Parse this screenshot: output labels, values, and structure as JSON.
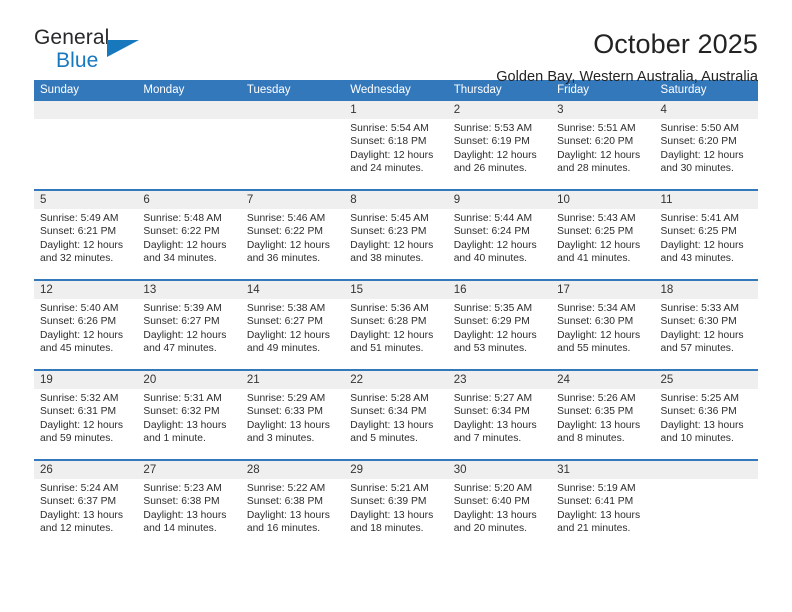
{
  "brand": {
    "name_top": "General",
    "name_bottom": "Blue",
    "triangle_color": "#1878be"
  },
  "header": {
    "month_title": "October 2025",
    "location": "Golden Bay, Western Australia, Australia",
    "accent_color": "#3478bc"
  },
  "weekdays": [
    "Sunday",
    "Monday",
    "Tuesday",
    "Wednesday",
    "Thursday",
    "Friday",
    "Saturday"
  ],
  "weeks": [
    [
      {
        "day": "",
        "empty": true
      },
      {
        "day": "",
        "empty": true
      },
      {
        "day": "",
        "empty": true
      },
      {
        "day": "1",
        "sunrise": "Sunrise: 5:54 AM",
        "sunset": "Sunset: 6:18 PM",
        "daylight_1": "Daylight: 12 hours",
        "daylight_2": "and 24 minutes."
      },
      {
        "day": "2",
        "sunrise": "Sunrise: 5:53 AM",
        "sunset": "Sunset: 6:19 PM",
        "daylight_1": "Daylight: 12 hours",
        "daylight_2": "and 26 minutes."
      },
      {
        "day": "3",
        "sunrise": "Sunrise: 5:51 AM",
        "sunset": "Sunset: 6:20 PM",
        "daylight_1": "Daylight: 12 hours",
        "daylight_2": "and 28 minutes."
      },
      {
        "day": "4",
        "sunrise": "Sunrise: 5:50 AM",
        "sunset": "Sunset: 6:20 PM",
        "daylight_1": "Daylight: 12 hours",
        "daylight_2": "and 30 minutes."
      }
    ],
    [
      {
        "day": "5",
        "sunrise": "Sunrise: 5:49 AM",
        "sunset": "Sunset: 6:21 PM",
        "daylight_1": "Daylight: 12 hours",
        "daylight_2": "and 32 minutes."
      },
      {
        "day": "6",
        "sunrise": "Sunrise: 5:48 AM",
        "sunset": "Sunset: 6:22 PM",
        "daylight_1": "Daylight: 12 hours",
        "daylight_2": "and 34 minutes."
      },
      {
        "day": "7",
        "sunrise": "Sunrise: 5:46 AM",
        "sunset": "Sunset: 6:22 PM",
        "daylight_1": "Daylight: 12 hours",
        "daylight_2": "and 36 minutes."
      },
      {
        "day": "8",
        "sunrise": "Sunrise: 5:45 AM",
        "sunset": "Sunset: 6:23 PM",
        "daylight_1": "Daylight: 12 hours",
        "daylight_2": "and 38 minutes."
      },
      {
        "day": "9",
        "sunrise": "Sunrise: 5:44 AM",
        "sunset": "Sunset: 6:24 PM",
        "daylight_1": "Daylight: 12 hours",
        "daylight_2": "and 40 minutes."
      },
      {
        "day": "10",
        "sunrise": "Sunrise: 5:43 AM",
        "sunset": "Sunset: 6:25 PM",
        "daylight_1": "Daylight: 12 hours",
        "daylight_2": "and 41 minutes."
      },
      {
        "day": "11",
        "sunrise": "Sunrise: 5:41 AM",
        "sunset": "Sunset: 6:25 PM",
        "daylight_1": "Daylight: 12 hours",
        "daylight_2": "and 43 minutes."
      }
    ],
    [
      {
        "day": "12",
        "sunrise": "Sunrise: 5:40 AM",
        "sunset": "Sunset: 6:26 PM",
        "daylight_1": "Daylight: 12 hours",
        "daylight_2": "and 45 minutes."
      },
      {
        "day": "13",
        "sunrise": "Sunrise: 5:39 AM",
        "sunset": "Sunset: 6:27 PM",
        "daylight_1": "Daylight: 12 hours",
        "daylight_2": "and 47 minutes."
      },
      {
        "day": "14",
        "sunrise": "Sunrise: 5:38 AM",
        "sunset": "Sunset: 6:27 PM",
        "daylight_1": "Daylight: 12 hours",
        "daylight_2": "and 49 minutes."
      },
      {
        "day": "15",
        "sunrise": "Sunrise: 5:36 AM",
        "sunset": "Sunset: 6:28 PM",
        "daylight_1": "Daylight: 12 hours",
        "daylight_2": "and 51 minutes."
      },
      {
        "day": "16",
        "sunrise": "Sunrise: 5:35 AM",
        "sunset": "Sunset: 6:29 PM",
        "daylight_1": "Daylight: 12 hours",
        "daylight_2": "and 53 minutes."
      },
      {
        "day": "17",
        "sunrise": "Sunrise: 5:34 AM",
        "sunset": "Sunset: 6:30 PM",
        "daylight_1": "Daylight: 12 hours",
        "daylight_2": "and 55 minutes."
      },
      {
        "day": "18",
        "sunrise": "Sunrise: 5:33 AM",
        "sunset": "Sunset: 6:30 PM",
        "daylight_1": "Daylight: 12 hours",
        "daylight_2": "and 57 minutes."
      }
    ],
    [
      {
        "day": "19",
        "sunrise": "Sunrise: 5:32 AM",
        "sunset": "Sunset: 6:31 PM",
        "daylight_1": "Daylight: 12 hours",
        "daylight_2": "and 59 minutes."
      },
      {
        "day": "20",
        "sunrise": "Sunrise: 5:31 AM",
        "sunset": "Sunset: 6:32 PM",
        "daylight_1": "Daylight: 13 hours",
        "daylight_2": "and 1 minute."
      },
      {
        "day": "21",
        "sunrise": "Sunrise: 5:29 AM",
        "sunset": "Sunset: 6:33 PM",
        "daylight_1": "Daylight: 13 hours",
        "daylight_2": "and 3 minutes."
      },
      {
        "day": "22",
        "sunrise": "Sunrise: 5:28 AM",
        "sunset": "Sunset: 6:34 PM",
        "daylight_1": "Daylight: 13 hours",
        "daylight_2": "and 5 minutes."
      },
      {
        "day": "23",
        "sunrise": "Sunrise: 5:27 AM",
        "sunset": "Sunset: 6:34 PM",
        "daylight_1": "Daylight: 13 hours",
        "daylight_2": "and 7 minutes."
      },
      {
        "day": "24",
        "sunrise": "Sunrise: 5:26 AM",
        "sunset": "Sunset: 6:35 PM",
        "daylight_1": "Daylight: 13 hours",
        "daylight_2": "and 8 minutes."
      },
      {
        "day": "25",
        "sunrise": "Sunrise: 5:25 AM",
        "sunset": "Sunset: 6:36 PM",
        "daylight_1": "Daylight: 13 hours",
        "daylight_2": "and 10 minutes."
      }
    ],
    [
      {
        "day": "26",
        "sunrise": "Sunrise: 5:24 AM",
        "sunset": "Sunset: 6:37 PM",
        "daylight_1": "Daylight: 13 hours",
        "daylight_2": "and 12 minutes."
      },
      {
        "day": "27",
        "sunrise": "Sunrise: 5:23 AM",
        "sunset": "Sunset: 6:38 PM",
        "daylight_1": "Daylight: 13 hours",
        "daylight_2": "and 14 minutes."
      },
      {
        "day": "28",
        "sunrise": "Sunrise: 5:22 AM",
        "sunset": "Sunset: 6:38 PM",
        "daylight_1": "Daylight: 13 hours",
        "daylight_2": "and 16 minutes."
      },
      {
        "day": "29",
        "sunrise": "Sunrise: 5:21 AM",
        "sunset": "Sunset: 6:39 PM",
        "daylight_1": "Daylight: 13 hours",
        "daylight_2": "and 18 minutes."
      },
      {
        "day": "30",
        "sunrise": "Sunrise: 5:20 AM",
        "sunset": "Sunset: 6:40 PM",
        "daylight_1": "Daylight: 13 hours",
        "daylight_2": "and 20 minutes."
      },
      {
        "day": "31",
        "sunrise": "Sunrise: 5:19 AM",
        "sunset": "Sunset: 6:41 PM",
        "daylight_1": "Daylight: 13 hours",
        "daylight_2": "and 21 minutes."
      },
      {
        "day": "",
        "empty": true
      }
    ]
  ]
}
